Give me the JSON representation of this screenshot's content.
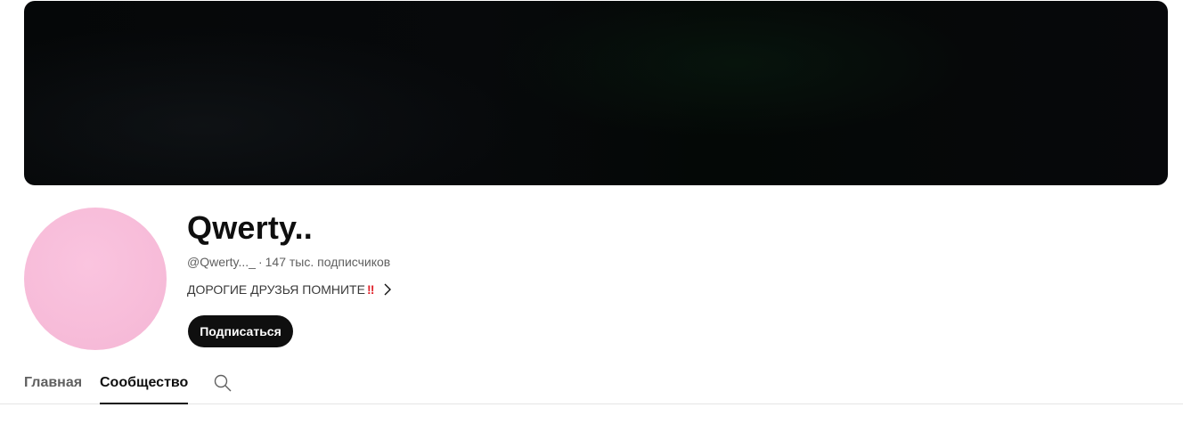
{
  "channel": {
    "name": "Qwerty..",
    "handle": "@Qwerty..._",
    "separator": "·",
    "subscribers": "147 тыс. подписчиков",
    "description": "ДОРОГИЕ ДРУЗЬЯ ПОМНИТЕ",
    "description_emoji": "‼",
    "avatar_color": "#f7bcd9",
    "banner_color": "#06080a"
  },
  "actions": {
    "subscribe_label": "Подписаться"
  },
  "tabs": [
    {
      "label": "Главная",
      "active": false
    },
    {
      "label": "Сообщество",
      "active": true
    }
  ],
  "icons": {
    "description_more": "chevron-right-icon",
    "tab_search": "search-icon"
  }
}
